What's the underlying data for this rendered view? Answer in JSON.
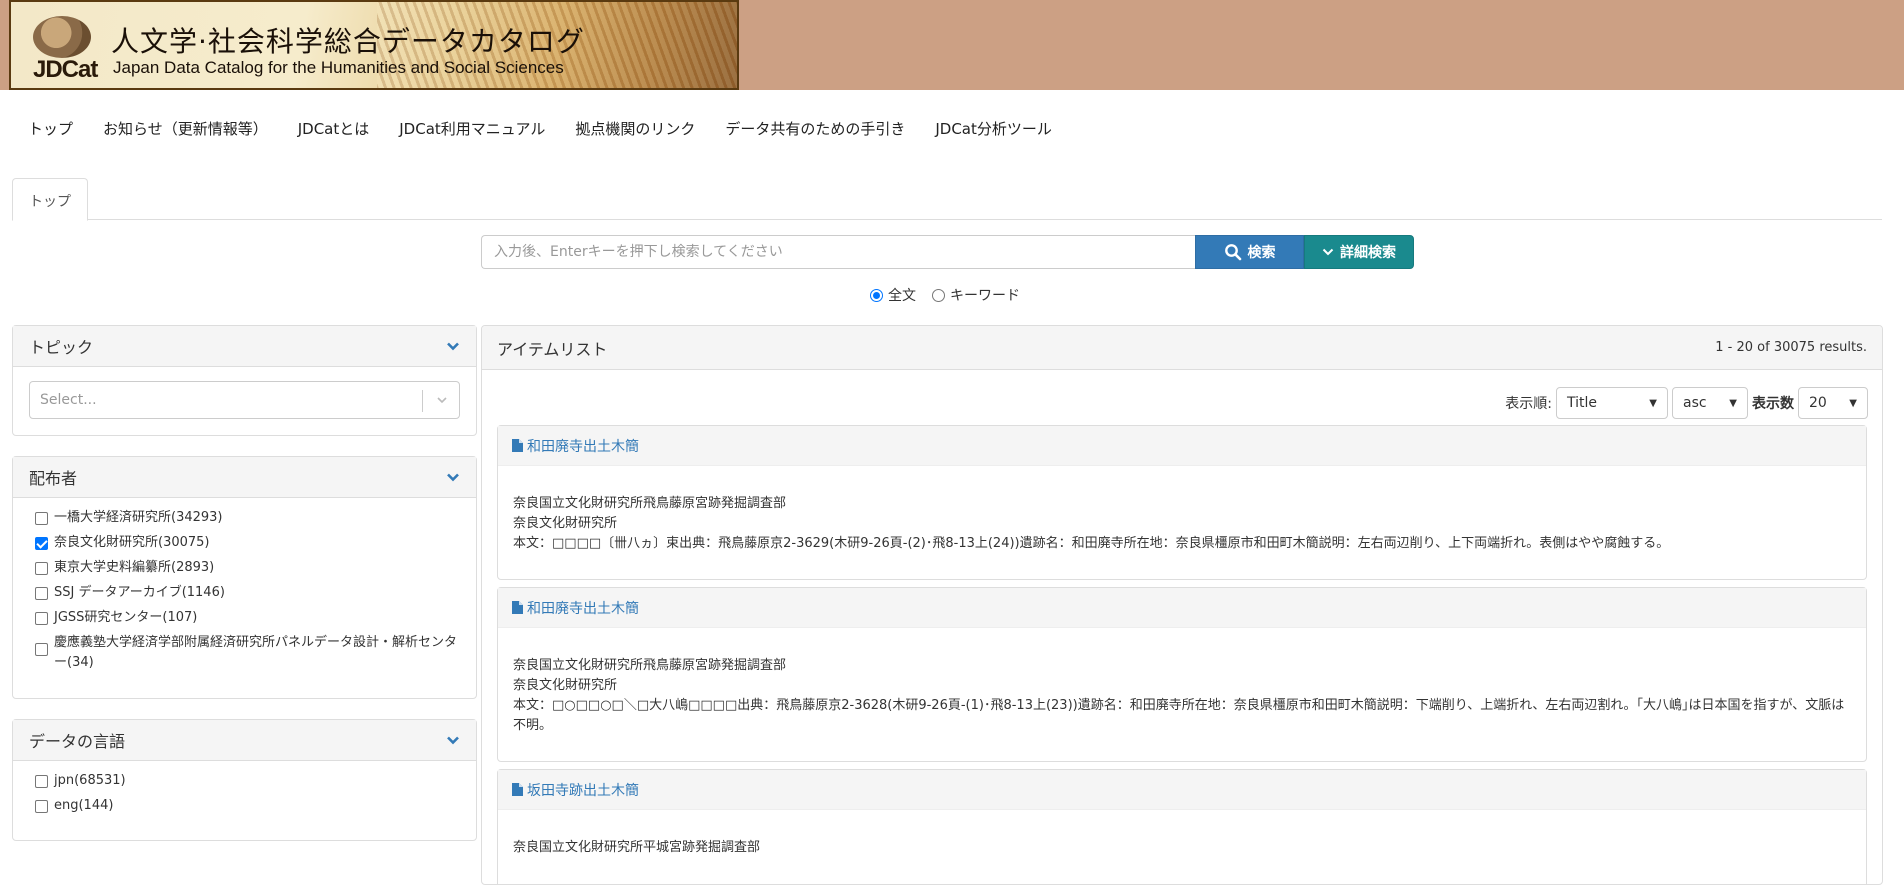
{
  "header": {
    "logo_abbr": "JDCat",
    "title": "人文学·社会科学総合データカタログ",
    "subtitle": "Japan Data Catalog for the Humanities and Social Sciences"
  },
  "nav": {
    "items": [
      "トップ",
      "お知らせ（更新情報等）",
      "JDCatとは",
      "JDCat利用マニュアル",
      "拠点機関のリンク",
      "データ共有のための手引き",
      "JDCat分析ツール"
    ]
  },
  "tabs": {
    "active": "トップ"
  },
  "search": {
    "placeholder": "入力後、Enterキーを押下し検索してください",
    "value": "",
    "search_label": "検索",
    "detail_label": "詳細検索",
    "options": [
      "全文",
      "キーワード"
    ],
    "selected_option": "全文"
  },
  "sidebar": {
    "topic": {
      "title": "トピック",
      "select_placeholder": "Select..."
    },
    "distributor": {
      "title": "配布者",
      "items": [
        {
          "label": "一橋大学経済研究所(34293)",
          "checked": false
        },
        {
          "label": "奈良文化財研究所(30075)",
          "checked": true
        },
        {
          "label": "東京大学史料編纂所(2893)",
          "checked": false
        },
        {
          "label": "SSJ データアーカイブ(1146)",
          "checked": false
        },
        {
          "label": "JGSS研究センター(107)",
          "checked": false
        },
        {
          "label": "慶應義塾大学経済学部附属経済研究所パネルデータ設計・解析センター(34)",
          "checked": false
        }
      ]
    },
    "language": {
      "title": "データの言語",
      "items": [
        {
          "label": "jpn(68531)",
          "checked": false
        },
        {
          "label": "eng(144)",
          "checked": false
        }
      ]
    }
  },
  "main": {
    "title": "アイテムリスト",
    "results": "1 - 20 of 30075 results.",
    "sort_label": "表示順:",
    "sort_field": "Title",
    "sort_order": "asc",
    "count_label": "表示数",
    "count_value": "20",
    "items": [
      {
        "title": "和田廃寺出土木簡",
        "line1": "奈良国立文化財研究所飛鳥藤原宮跡発掘調査部",
        "line2": "奈良文化財研究所",
        "line3": "本文：□□□□〔卌八ヵ〕束出典：飛鳥藤原京2-3629(木研9-26頁-(2)･飛8-13上(24))遺跡名：和田廃寺所在地：奈良県橿原市和田町木簡説明：左右両辺削り、上下両端折れ。表側はやや腐蝕する。"
      },
      {
        "title": "和田廃寺出土木簡",
        "line1": "奈良国立文化財研究所飛鳥藤原宮跡発掘調査部",
        "line2": "奈良文化財研究所",
        "line3": "本文：□○□□○□＼□大八嶋□□□□出典：飛鳥藤原京2-3628(木研9-26頁-(1)･飛8-13上(23))遺跡名：和田廃寺所在地：奈良県橿原市和田町木簡説明：下端削り、上端折れ、左右両辺割れ。｢大八嶋｣は日本国を指すが、文脈は不明。"
      },
      {
        "title": "坂田寺跡出土木簡",
        "line1": "奈良国立文化財研究所平城宮跡発掘調査部",
        "line2": "",
        "line3": ""
      }
    ]
  },
  "colors": {
    "header_bg": "#cca084",
    "link": "#337ab7",
    "search_btn": "#337ab7",
    "detail_btn": "#1a8a8e"
  }
}
